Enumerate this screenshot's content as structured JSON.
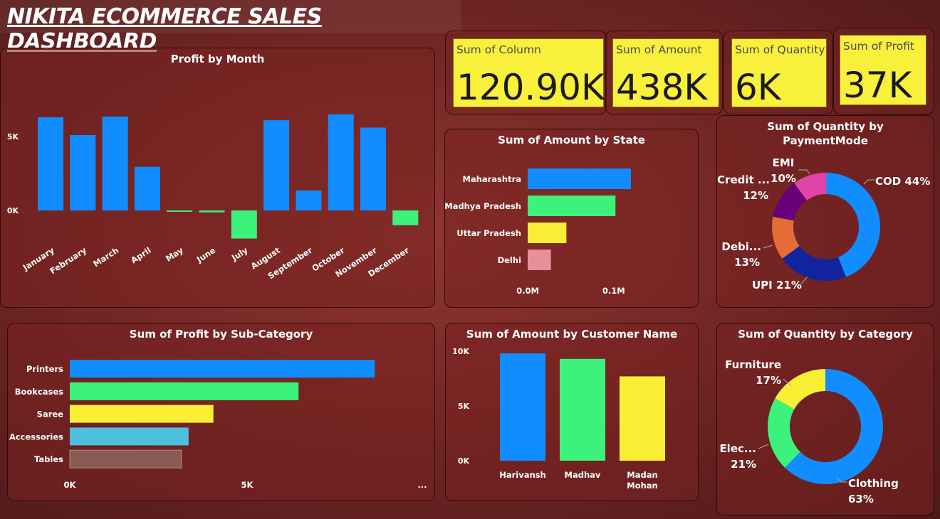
{
  "title": "NIKITA ECOMMERCE SALES DASHBOARD",
  "kpis": [
    {
      "label": "Sum of Column",
      "value": "120.90K"
    },
    {
      "label": "Sum of Amount",
      "value": "438K"
    },
    {
      "label": "Sum of Quantity",
      "value": "6K"
    },
    {
      "label": "Sum of Profit",
      "value": "37K"
    }
  ],
  "colors": {
    "blue": "#118dff",
    "green": "#3cf27a",
    "yellow": "#f8ef35",
    "pink": "#e8909a",
    "teal": "#4dc0dd",
    "brown": "#8a5a55",
    "navy": "#12239e",
    "orange": "#e66c37",
    "purple": "#6b007b",
    "magenta": "#e044a7",
    "kpi_bg": "#f9f03b"
  },
  "chart_data": [
    {
      "id": "profit_by_month",
      "type": "bar",
      "title": "Profit by Month",
      "categories": [
        "January",
        "February",
        "March",
        "April",
        "May",
        "June",
        "July",
        "August",
        "September",
        "October",
        "November",
        "December"
      ],
      "values": [
        6300,
        5100,
        6350,
        2950,
        -80,
        -130,
        -1900,
        6100,
        1350,
        6500,
        5600,
        -1000
      ],
      "yticks": [
        "5K",
        "0K"
      ],
      "ylim": [
        -2000,
        7000
      ]
    },
    {
      "id": "amount_by_state",
      "type": "bar",
      "orientation": "horizontal",
      "title": "Sum of Amount by State",
      "categories": [
        "Maharashtra",
        "Madhya Pradesh",
        "Uttar Pradesh",
        "Delhi"
      ],
      "values": [
        0.12,
        0.102,
        0.045,
        0.027
      ],
      "xticks": [
        "0.0M",
        "0.1M"
      ],
      "xlim": [
        0,
        0.13
      ]
    },
    {
      "id": "quantity_by_paymentmode",
      "type": "pie",
      "donut": true,
      "title": "Sum of Quantity by PaymentMode",
      "title_lines": [
        "Sum of Quantity by",
        "PaymentMode"
      ],
      "slices": [
        {
          "label": "COD",
          "percent": 44,
          "display": "COD 44%"
        },
        {
          "label": "UPI",
          "percent": 21,
          "display": "UPI 21%"
        },
        {
          "label": "Debi...",
          "percent": 13,
          "display_name": "Debi...",
          "display_pct": "13%"
        },
        {
          "label": "Credit ...",
          "percent": 12,
          "display_name": "Credit ...",
          "display_pct": "12%"
        },
        {
          "label": "EMI",
          "percent": 10,
          "display_name": "EMI",
          "display_pct": "10%"
        }
      ]
    },
    {
      "id": "profit_by_subcategory",
      "type": "bar",
      "orientation": "horizontal",
      "title": "Sum of Profit by Sub-Category",
      "categories": [
        "Printers",
        "Bookcases",
        "Saree",
        "Accessories",
        "Tables"
      ],
      "values": [
        8600,
        6450,
        4050,
        3350,
        3150
      ],
      "xticks": [
        "0K",
        "5K",
        "..."
      ],
      "xlim": [
        0,
        10000
      ]
    },
    {
      "id": "amount_by_customer",
      "type": "bar",
      "title": "Sum of Amount by Customer Name",
      "categories": [
        "Harivansh",
        "Madhav",
        "Madan Mohan"
      ],
      "category_lines": [
        [
          "Harivansh"
        ],
        [
          "Madhav"
        ],
        [
          "Madan",
          "Mohan"
        ]
      ],
      "values": [
        9800,
        9300,
        7700
      ],
      "yticks": [
        "10K",
        "5K",
        "0K"
      ],
      "ylim": [
        0,
        10000
      ]
    },
    {
      "id": "quantity_by_category",
      "type": "pie",
      "donut": true,
      "title": "Sum of Quantity by Category",
      "slices": [
        {
          "label": "Clothing",
          "percent": 63,
          "display_name": "Clothing",
          "display_pct": "63%"
        },
        {
          "label": "Elec...",
          "percent": 21,
          "display_name": "Elec...",
          "display_pct": "21%"
        },
        {
          "label": "Furniture",
          "percent": 17,
          "display_name": "Furniture",
          "display_pct": "17%"
        }
      ]
    }
  ]
}
